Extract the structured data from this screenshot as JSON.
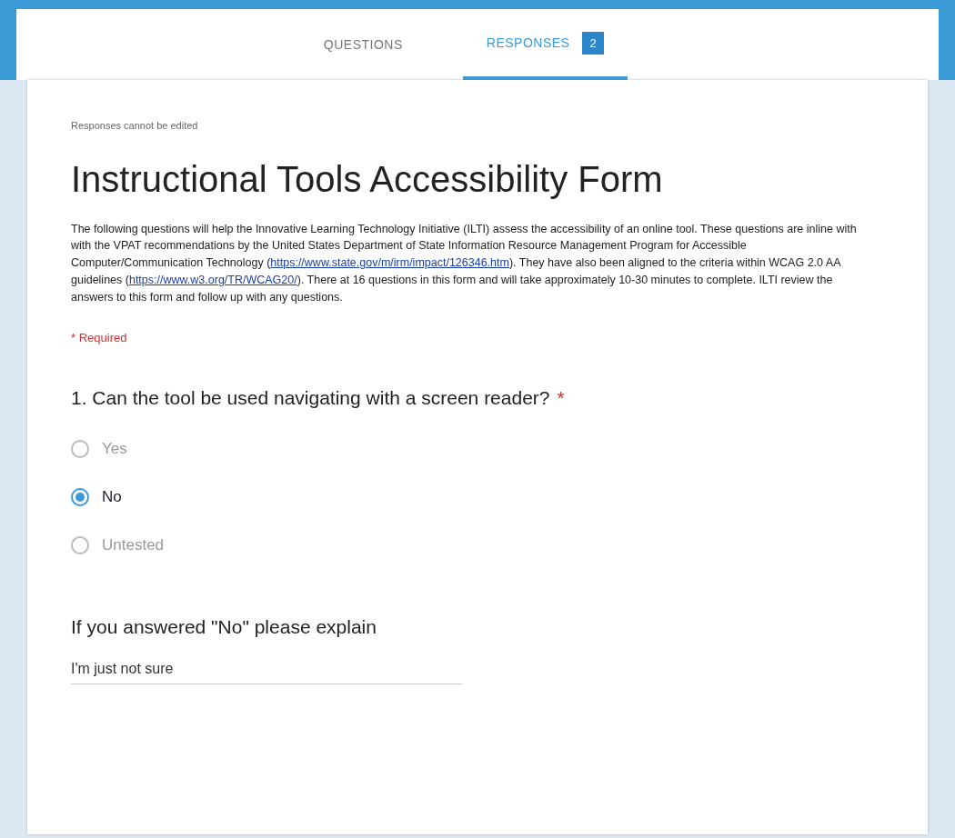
{
  "tabs": [
    {
      "label": "QUESTIONS",
      "selected": false
    },
    {
      "label": "RESPONSES",
      "selected": true,
      "count": "2"
    }
  ],
  "notice": "Responses cannot be edited",
  "title": "Instructional Tools Accessibility Form",
  "description": [
    {
      "kind": "text",
      "text": "The following questions will help the Innovative Learning Technology Initiative (ILTI) assess the accessibility of an online tool. These questions are inline with with the VPAT recommendations by the United States Department of State Information Resource Management Program for Accessible Computer/Communication Technology ("
    },
    {
      "kind": "link",
      "text": "https://www.state.gov/m/irm/impact/126346.htm"
    },
    {
      "kind": "text",
      "text": ").  They have also been aligned to the criteria within WCAG 2.0 AA guidelines ("
    },
    {
      "kind": "link",
      "text": "https://www.w3.org/TR/WCAG20/"
    },
    {
      "kind": "text",
      "text": "). There at 16 questions in this form and will take approximately 10-30 minutes to complete. ILTI review the answers to this form and follow up with any questions."
    }
  ],
  "required_note": "* Required",
  "questions": [
    {
      "kind": "radio",
      "title": "1. Can the tool be used navigating with a screen reader?",
      "required_mark": "*",
      "options": [
        {
          "label": "Yes",
          "selected": false
        },
        {
          "label": "No",
          "selected": true
        },
        {
          "label": "Untested",
          "selected": false
        }
      ]
    },
    {
      "kind": "text",
      "title": "If you answered \"No\" please explain",
      "value": "I'm just not sure"
    }
  ]
}
